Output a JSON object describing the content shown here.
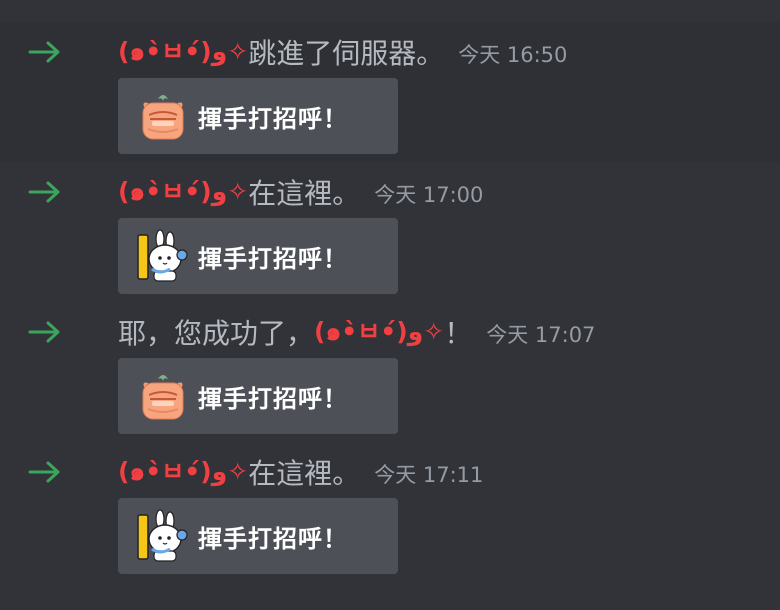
{
  "colors": {
    "background": "#313338",
    "hover_row": "#2e3035",
    "username": "#f23f42",
    "text": "#b5bac1",
    "timestamp": "#949ba4",
    "join_arrow": "#3ba55d",
    "button": "#4e5058"
  },
  "messages": [
    {
      "icon": "join-arrow-icon",
      "username": "(๑•̀ㅂ•́)و✧",
      "text": "跳進了伺服器。",
      "timestamp": "今天 16:50",
      "wave_label": "揮手打招呼！",
      "sticker": "orange-cat-sticker"
    },
    {
      "icon": "join-arrow-icon",
      "username": "(๑•̀ㅂ•́)و✧",
      "text": "在這裡。",
      "timestamp": "今天 17:00",
      "wave_label": "揮手打招呼！",
      "sticker": "white-bunny-sticker"
    },
    {
      "icon": "join-arrow-icon",
      "prefix": "耶，您成功了，",
      "username": "(๑•̀ㅂ•́)و✧",
      "suffix": "！",
      "timestamp": "今天 17:07",
      "wave_label": "揮手打招呼！",
      "sticker": "orange-cat-sticker"
    },
    {
      "icon": "join-arrow-icon",
      "username": "(๑•̀ㅂ•́)و✧",
      "text": "在這裡。",
      "timestamp": "今天 17:11",
      "wave_label": "揮手打招呼！",
      "sticker": "white-bunny-sticker"
    }
  ]
}
